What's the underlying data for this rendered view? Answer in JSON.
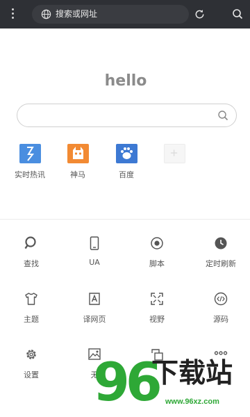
{
  "topbar": {
    "address_placeholder": "搜索或网址",
    "icons": [
      "menu-dots-icon",
      "globe-icon",
      "reload-icon",
      "search-icon"
    ]
  },
  "home": {
    "heading": "hello",
    "search_input_value": ""
  },
  "quick_links": [
    {
      "label": "实时热讯",
      "icon": "hot-news-icon",
      "color": "#4a8ee0"
    },
    {
      "label": "神马",
      "icon": "shenma-icon",
      "color": "#f28a33"
    },
    {
      "label": "百度",
      "icon": "baidu-icon",
      "color": "#3d79d3"
    },
    {
      "label": "",
      "icon": "add-shortcut-icon",
      "color": "#f6f6f6"
    }
  ],
  "tools": [
    {
      "label": "查找",
      "icon": "find-icon"
    },
    {
      "label": "UA",
      "icon": "phone-ua-icon"
    },
    {
      "label": "脚本",
      "icon": "script-icon"
    },
    {
      "label": "定时刷新",
      "icon": "clock-icon"
    },
    {
      "label": "主题",
      "icon": "theme-shirt-icon"
    },
    {
      "label": "译网页",
      "icon": "translate-icon"
    },
    {
      "label": "视野",
      "icon": "fullscreen-icon"
    },
    {
      "label": "源码",
      "icon": "source-code-icon"
    },
    {
      "label": "设置",
      "icon": "settings-gear-icon"
    },
    {
      "label": "无",
      "icon": "no-image-icon"
    },
    {
      "label": "",
      "icon": "save-icon"
    },
    {
      "label": "",
      "icon": "more-icon"
    }
  ],
  "watermark": {
    "number": "96",
    "text": "下载站",
    "url": "www.96xz.com"
  },
  "colors": {
    "topbar": "#2e3035",
    "address_bar": "#3a3c41",
    "watermark_green": "#2ea836"
  }
}
